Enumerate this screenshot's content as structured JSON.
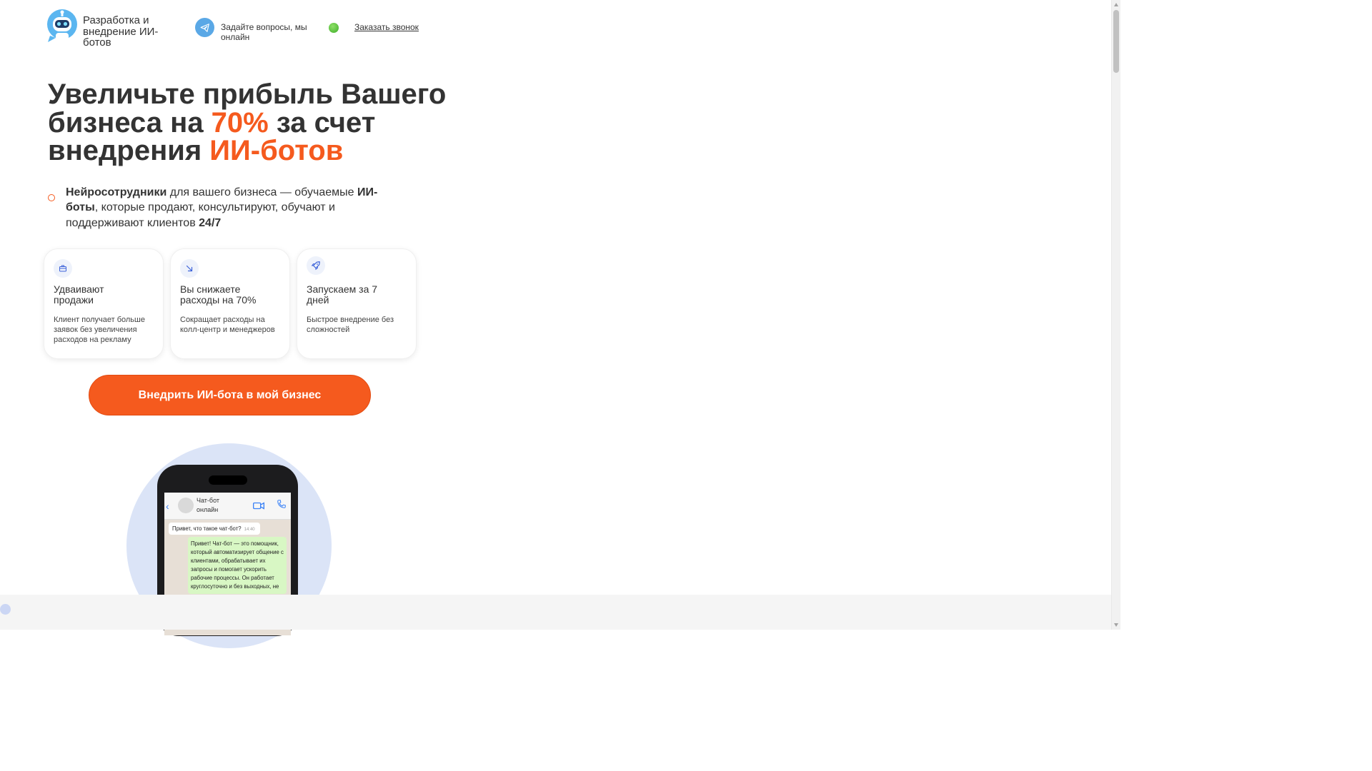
{
  "header": {
    "brand": "Разработка и внедрение ИИ-ботов",
    "ask_online": "Задайте вопросы, мы онлайн",
    "call_link": "Заказать звонок"
  },
  "hero": {
    "title_part1": "Увеличьте прибыль Вашего бизнеса на ",
    "title_accent1": "70%",
    "title_part2": " за счет внедрения ",
    "title_accent2": "ИИ-ботов",
    "lead_bold1": "Нейросотрудники",
    "lead_text1": " для вашего бизнеса — обучаемые ",
    "lead_bold2": "ИИ-боты",
    "lead_text2": ", которые продают, консультируют, обучают и поддерживают клиентов ",
    "lead_bold3": "24/7"
  },
  "cards": [
    {
      "icon": "briefcase-icon",
      "title": "Удваивают продажи",
      "text": "Клиент получает больше заявок без увеличения расходов на рекламу"
    },
    {
      "icon": "arrow-down-right-icon",
      "title": "Вы снижаете расходы на 70%",
      "text": "Сокращает расходы на колл-центр и менеджеров"
    },
    {
      "icon": "rocket-icon",
      "title": "Запускаем за 7 дней",
      "text": "Быстрое внедрение без сложностей"
    }
  ],
  "cta": {
    "label": "Внедрить ИИ-бота в мой бизнес"
  },
  "phone_chat": {
    "contact": "Чат-бот онлайн",
    "incoming": "Привет, что такое чат-бот?",
    "incoming_time": "14:40",
    "outgoing": "Привет! Чат-бот — это помощник, который автоматизирует общение с клиентами, обрабатывает их запросы и помогает ускорить рабочие процессы. Он работает круглосуточно и без выходных, не"
  },
  "colors": {
    "accent": "#f55a1e",
    "telegram": "#5aa8e6",
    "online": "#3fae2a",
    "card_icon_bg": "#eef2fb"
  }
}
